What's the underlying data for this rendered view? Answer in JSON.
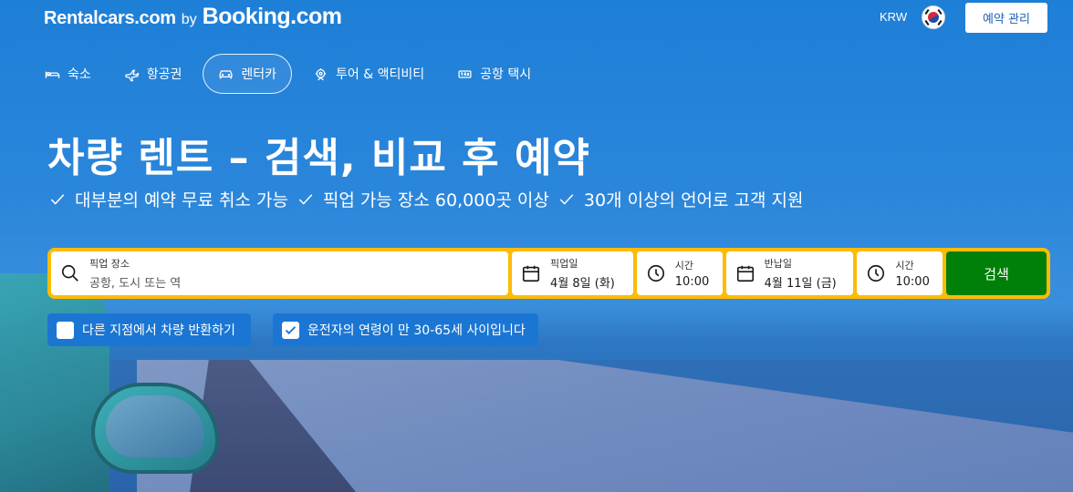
{
  "header": {
    "brand_primary": "Rentalcars.com",
    "brand_by": "by",
    "brand_secondary": "Booking.com",
    "currency": "KRW",
    "flag_icon": "south-korea-flag-icon",
    "manage_button": "예약 관리"
  },
  "nav": {
    "items": [
      {
        "label": "숙소",
        "icon": "bed-icon",
        "active": false
      },
      {
        "label": "항공권",
        "icon": "airplane-icon",
        "active": false
      },
      {
        "label": "렌터카",
        "icon": "car-icon",
        "active": true
      },
      {
        "label": "투어 & 액티비티",
        "icon": "attraction-icon",
        "active": false
      },
      {
        "label": "공항 택시",
        "icon": "taxi-icon",
        "active": false
      }
    ]
  },
  "hero": {
    "title": "차량 렌트 – 검색, 비교 후 예약",
    "features": [
      "대부분의 예약 무료 취소 가능",
      "픽업 가능 장소 60,000곳 이상",
      "30개 이상의 언어로 고객 지원"
    ]
  },
  "search": {
    "pickup_location_label": "픽업 장소",
    "pickup_location_placeholder": "공항, 도시 또는 역",
    "pickup_date_label": "픽업일",
    "pickup_date_value": "4월 8일 (화)",
    "pickup_time_label": "시간",
    "pickup_time_value": "10:00",
    "return_date_label": "반납일",
    "return_date_value": "4월 11일 (금)",
    "return_time_label": "시간",
    "return_time_value": "10:00",
    "search_button": "검색"
  },
  "options": {
    "different_return": {
      "label": "다른 지점에서 차량 반환하기",
      "checked": false
    },
    "driver_age": {
      "label": "운전자의 연령이 만 30-65세 사이입니다",
      "checked": true
    }
  },
  "colors": {
    "brand_blue": "#1f7fd6",
    "search_border": "#febb02",
    "search_button": "#008009",
    "checkbox_bg": "#1b76d3"
  }
}
